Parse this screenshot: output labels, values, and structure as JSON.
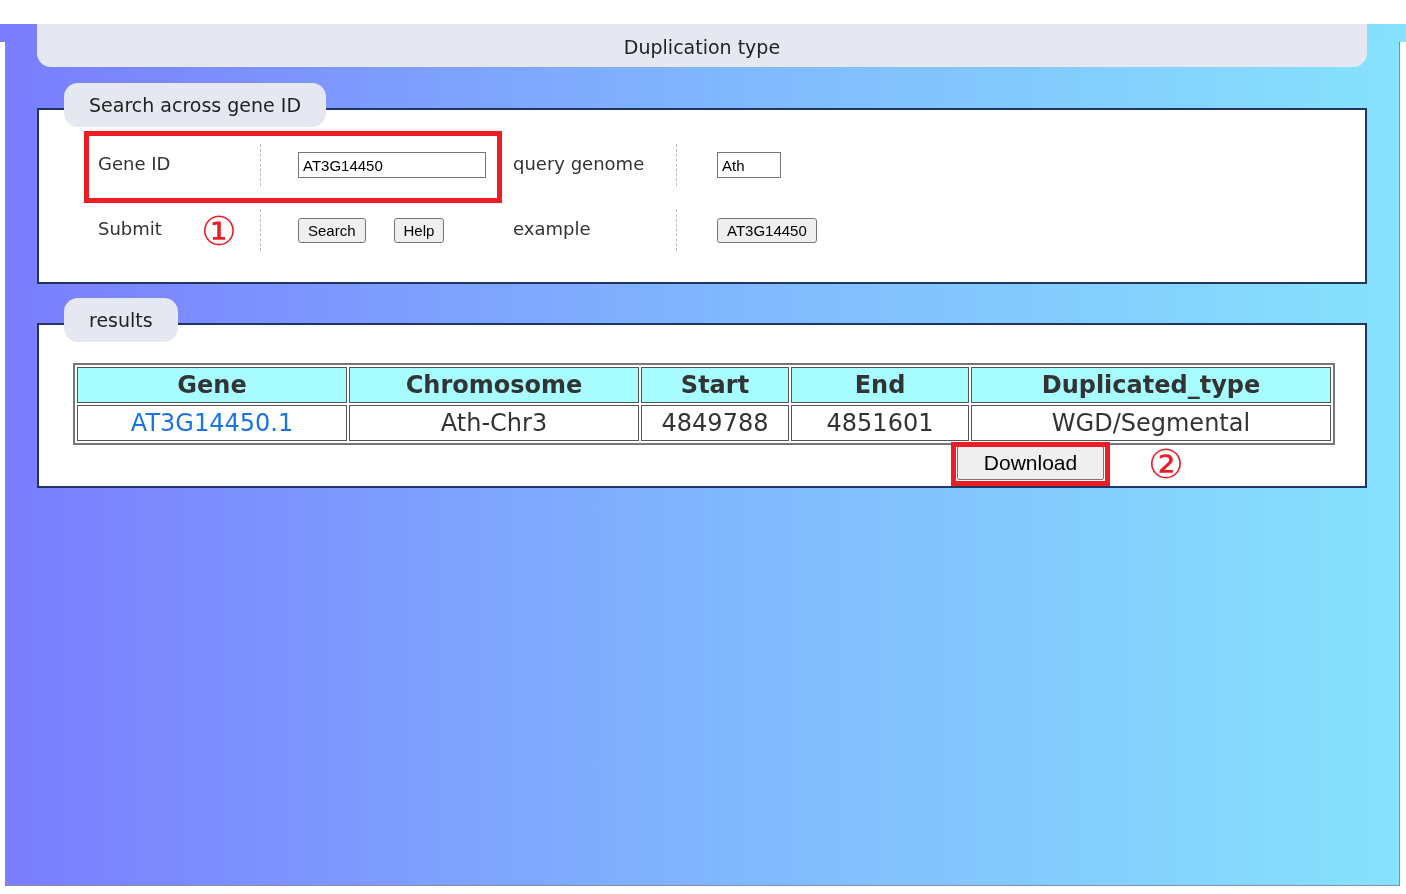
{
  "header": {
    "title": "Duplication type"
  },
  "search_panel": {
    "title": "Search across gene ID",
    "fields": [
      {
        "label": "Gene ID",
        "kind": "input",
        "value": "AT3G14450"
      },
      {
        "label": "query genome",
        "kind": "input",
        "value": "Ath"
      },
      {
        "label": "Submit",
        "kind": "buttons",
        "buttons": [
          "Search",
          "Help"
        ]
      },
      {
        "label": "example",
        "kind": "buttons",
        "buttons": [
          "AT3G14450"
        ]
      }
    ],
    "annotation": {
      "marker": "①"
    }
  },
  "results": {
    "title": "results",
    "table": {
      "columns": [
        "Gene",
        "Chromosome",
        "Start",
        "End",
        "Duplicated_type"
      ],
      "rows": [
        {
          "kind": "link",
          "cells": [
            "AT3G14450.1",
            "Ath-Chr3",
            "4849788",
            "4851601",
            "WGD/Segmental"
          ]
        }
      ]
    },
    "download_button": "Download",
    "annotation": {
      "marker": "②"
    }
  }
}
